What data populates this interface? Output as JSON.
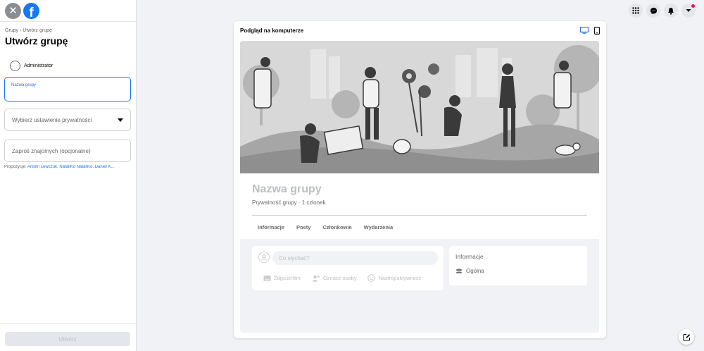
{
  "sidebar": {
    "breadcrumb": "Grupy › Utwórz grupę",
    "title": "Utwórz grupę",
    "admin_label": "Administrator",
    "name_field_label": "Nazwa grupy",
    "name_field_value": "",
    "privacy_placeholder": "Wybierz ustawienie prywatności",
    "invite_placeholder": "Zaproś znajomych (opcjonalne)",
    "suggestions_prefix": "Propozycje: ",
    "suggestions_names": "Artiom Lewczuk, NataliKo NataliKo, Daniel K...",
    "create_button": "Utwórz"
  },
  "header_icons": [
    "menu-grid-icon",
    "messenger-icon",
    "notifications-icon",
    "account-caret-icon"
  ],
  "preview": {
    "title": "Podgląd na komputerze",
    "devices": [
      "desktop-icon",
      "mobile-icon"
    ],
    "group_name": "Nazwa grupy",
    "group_meta": "Prywatność grupy · 1 członek",
    "tabs": [
      {
        "label": "Informacje"
      },
      {
        "label": "Posty"
      },
      {
        "label": "Członkowie"
      },
      {
        "label": "Wydarzenia"
      }
    ],
    "composer": {
      "placeholder": "Co słychać?",
      "actions": [
        {
          "label": "Zdjęcie/film",
          "icon": "photo-icon"
        },
        {
          "label": "Oznacz osoby",
          "icon": "tag-people-icon"
        },
        {
          "label": "Nastrój/aktywność",
          "icon": "feeling-icon"
        }
      ]
    },
    "about": {
      "title": "Informacje",
      "visibility": "Ogólna"
    }
  },
  "colors": {
    "accent": "#1877f2",
    "background": "#f0f2f5",
    "notification": "#e41e3f"
  }
}
